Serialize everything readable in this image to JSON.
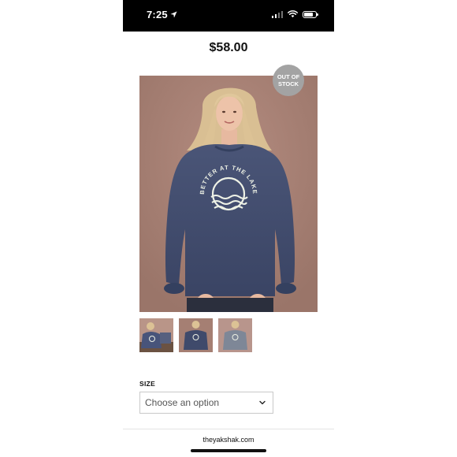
{
  "status_bar": {
    "time": "7:25",
    "icons": [
      "location-arrow-icon",
      "signal-icon",
      "wifi-icon",
      "battery-icon"
    ]
  },
  "product": {
    "price": "$58.00",
    "badge_line1": "OUT OF",
    "badge_line2": "STOCK",
    "sweatshirt_print": "BETTER AT THE LAKE",
    "thumbnails_count": 3
  },
  "options": {
    "size_label": "SIZE",
    "size_select_placeholder": "Choose an option"
  },
  "browser": {
    "url": "theyakshak.com"
  },
  "colors": {
    "photo_background": "#a57f73",
    "sweatshirt": "#3f4a6b",
    "badge": "#a3a3a3"
  }
}
